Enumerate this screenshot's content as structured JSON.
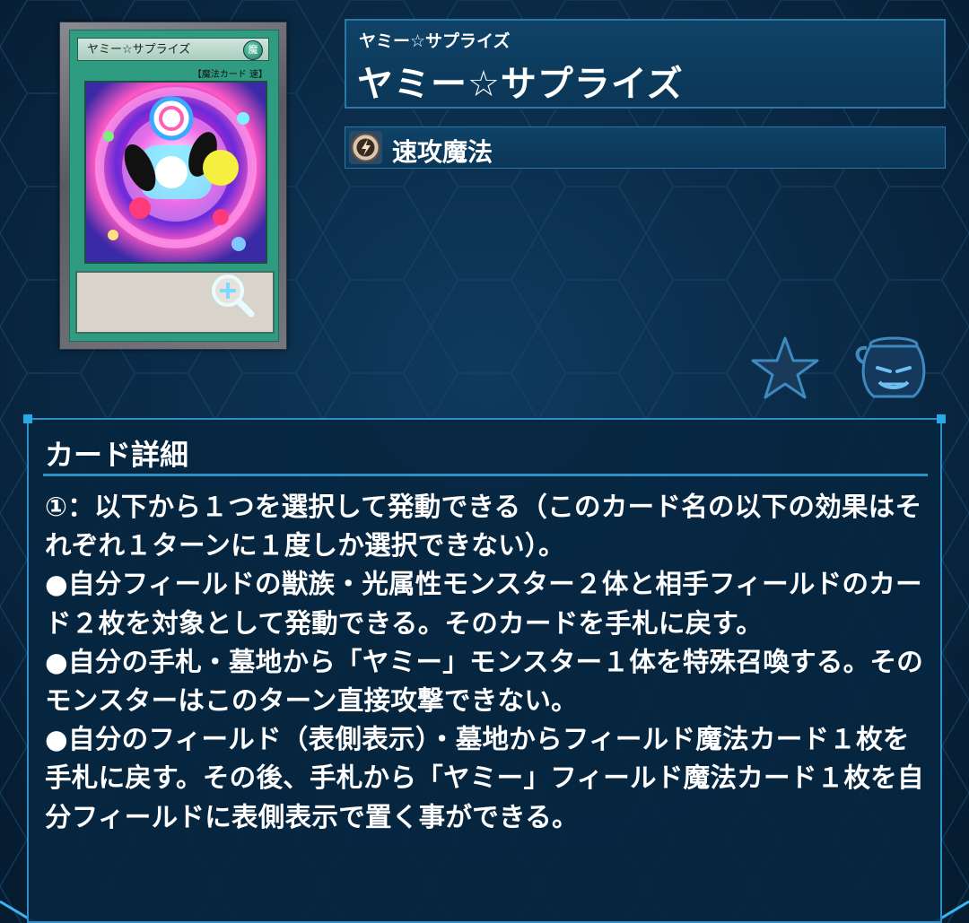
{
  "card": {
    "image_name": "ヤミー☆サプライズ",
    "image_type_line": "【魔法カード 速】",
    "name_ruby": "ヤミー☆サプライズ",
    "name": "ヤミー☆サプライズ",
    "spell_type_icon": "quick-play-spell-icon",
    "spell_type": "速攻魔法"
  },
  "actions": {
    "zoom_icon": "magnify-plus-icon",
    "favorite_icon": "star-icon",
    "pot_icon": "pot-of-greed-icon"
  },
  "details": {
    "title": "カード詳細",
    "text": "①：以下から１つを選択して発動できる（このカード名の以下の効果はそれぞれ１ターンに１度しか選択できない）。\n●自分フィールドの獣族・光属性モンスター２体と相手フィールドのカード２枚を対象として発動できる。そのカードを手札に戻す。\n●自分の手札・墓地から「ヤミー」モンスター１体を特殊召喚する。そのモンスターはこのターン直接攻撃できない。\n●自分のフィールド（表側表示）・墓地からフィールド魔法カード１枚を手札に戻す。その後、手札から「ヤミー」フィールド魔法カード１枚を自分フィールドに表側表示で置く事ができる。"
  },
  "colors": {
    "background": "#0a2a44",
    "panel_border": "#2a78a6",
    "card_green": "#2f9b80",
    "accent_blue": "#2aa8e8"
  }
}
